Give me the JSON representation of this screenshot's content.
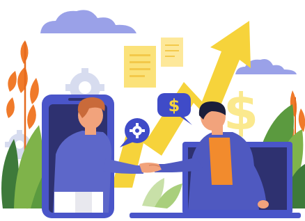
{
  "illustration": {
    "speech_bubble_left": {
      "icon": "gear-icon"
    },
    "speech_bubble_right": {
      "icon": "dollar-icon"
    },
    "background_symbol": {
      "icon": "dollar-sign-icon"
    },
    "trend": {
      "direction": "up"
    }
  },
  "colors": {
    "background": "#ffffff",
    "arrow": "#f6d33b",
    "arrow_light": "#fbe98e",
    "cloud": "#9aa1e8",
    "phone": "#4a55c9",
    "phone_screen": "#2e3170",
    "laptop": "#4a55c9",
    "speech_bubble": "#3f4bc8",
    "leaf_orange": "#f07a2a",
    "leaf_green": "#7fb34a",
    "leaf_dark": "#3e7a3a",
    "gear_light": "#d7dcef",
    "note_yellow": "#fbe27a",
    "shirt_left": "#5d67c9",
    "shirt_right_vest": "#f28b2d",
    "jacket_right": "#4f59c0",
    "skin": "#f2a37c",
    "hair": "#1b1d3a"
  }
}
